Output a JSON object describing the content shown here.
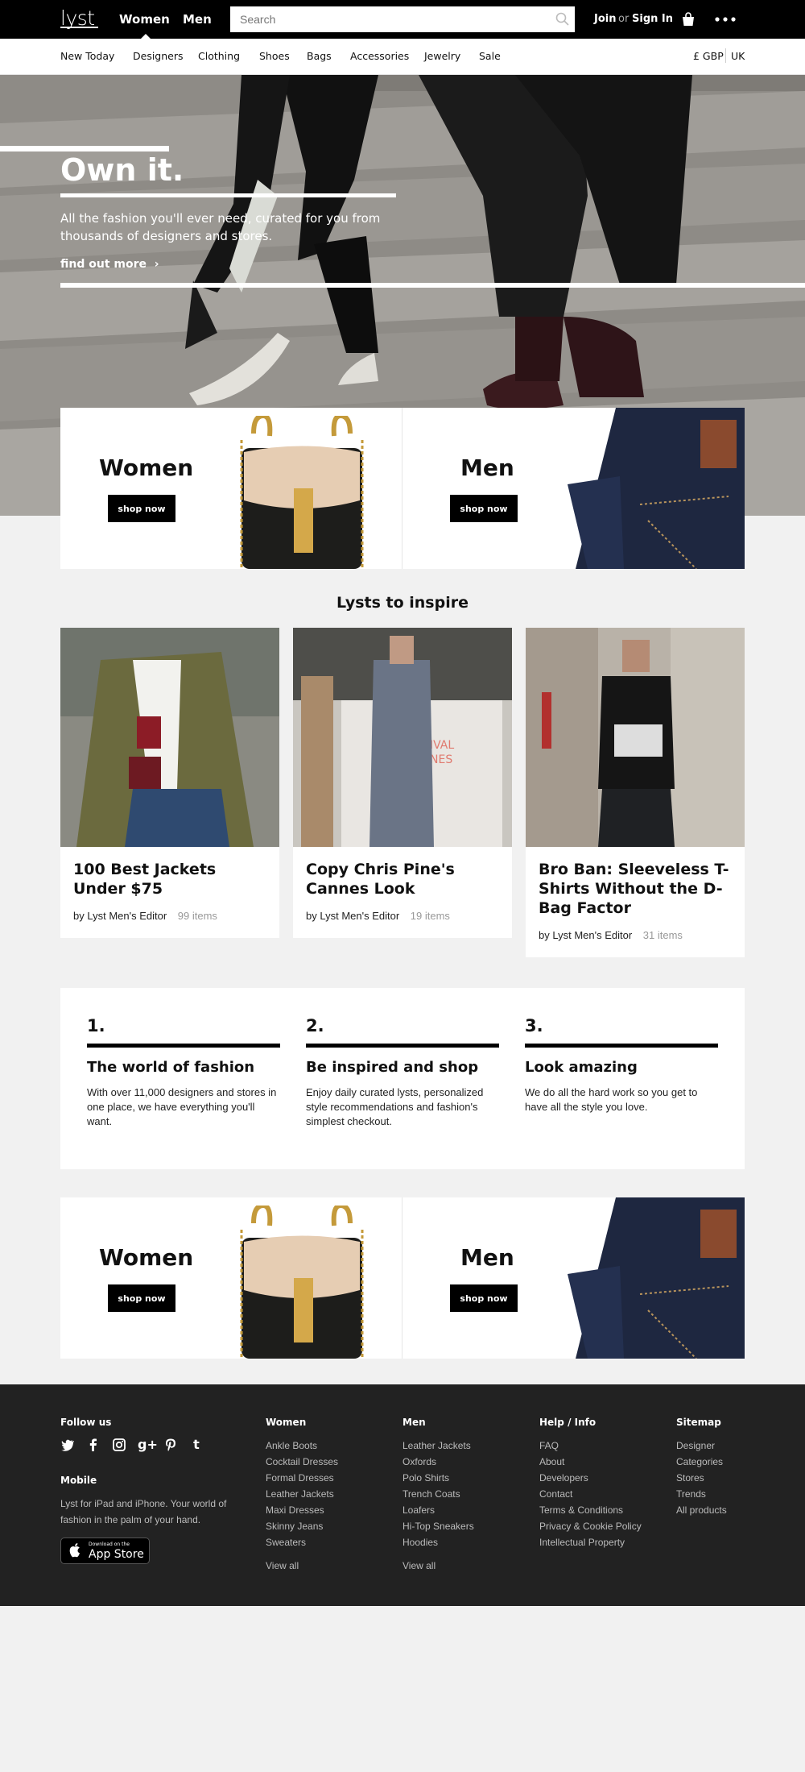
{
  "header": {
    "logo": "lyst",
    "nav": [
      "Women",
      "Men"
    ],
    "search_placeholder": "Search",
    "join": "Join",
    "or": "or",
    "sign_in": "Sign In"
  },
  "categories": [
    "New Today",
    "Designers",
    "Clothing",
    "Shoes",
    "Bags",
    "Accessories",
    "Jewelry",
    "Sale"
  ],
  "currency": "£ GBP",
  "region": "UK",
  "hero": {
    "title": "Own it.",
    "subtitle": "All the fashion you'll ever need, curated for you from thousands of designers and stores.",
    "link": "find out more"
  },
  "shop": {
    "women": "Women",
    "men": "Men",
    "button": "shop now"
  },
  "lysts_title": "Lysts to inspire",
  "lysts": [
    {
      "title": "100 Best Jackets Under $75",
      "author": "by Lyst Men's Editor",
      "count": "99 items"
    },
    {
      "title": "Copy Chris Pine's Cannes Look",
      "author": "by Lyst Men's Editor",
      "count": "19 items"
    },
    {
      "title": "Bro Ban: Sleeveless T-Shirts Without the D-Bag Factor",
      "author": "by Lyst Men's Editor",
      "count": "31 items"
    }
  ],
  "steps": [
    {
      "num": "1.",
      "title": "The world of fashion",
      "text": "With over 11,000 designers and stores in one place, we have everything you'll want."
    },
    {
      "num": "2.",
      "title": "Be inspired and shop",
      "text": "Enjoy daily curated lysts, personalized style recommendations and fashion's simplest checkout."
    },
    {
      "num": "3.",
      "title": "Look amazing",
      "text": "We do all the hard work so you get to have all the style you love."
    }
  ],
  "footer": {
    "follow_us": "Follow us",
    "social_icons": [
      "twitter-icon",
      "facebook-icon",
      "instagram-icon",
      "google-plus-icon",
      "pinterest-icon",
      "tumblr-icon"
    ],
    "mobile_head": "Mobile",
    "mobile_text": "Lyst for iPad and iPhone. Your world of fashion in the palm of your hand.",
    "appstore_small": "Download on the",
    "appstore_big": "App Store",
    "women_head": "Women",
    "women_links": [
      "Ankle Boots",
      "Cocktail Dresses",
      "Formal Dresses",
      "Leather Jackets",
      "Maxi Dresses",
      "Skinny Jeans",
      "Sweaters"
    ],
    "men_head": "Men",
    "men_links": [
      "Leather Jackets",
      "Oxfords",
      "Polo Shirts",
      "Trench Coats",
      "Loafers",
      "Hi-Top Sneakers",
      "Hoodies"
    ],
    "view_all": "View all",
    "help_head": "Help / Info",
    "help_links": [
      "FAQ",
      "About",
      "Developers",
      "Contact",
      "Terms & Conditions",
      "Privacy & Cookie Policy",
      "Intellectual Property"
    ],
    "sitemap_head": "Sitemap",
    "sitemap_links": [
      "Designer",
      "Categories",
      "Stores",
      "Trends",
      "All products"
    ]
  }
}
